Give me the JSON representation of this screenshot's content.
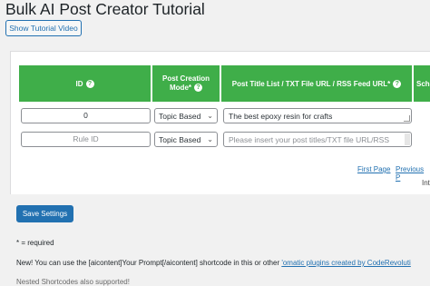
{
  "header": {
    "title": "Bulk AI Post Creator Tutorial",
    "tutorial_button": "Show Tutorial Video"
  },
  "table": {
    "columns": [
      {
        "label": "ID",
        "help_icon": "?"
      },
      {
        "label_line1": "Post Creation",
        "label_line2": "Mode*",
        "help_icon": "?"
      },
      {
        "label": "Post Title List / TXT File URL / RSS Feed URL*",
        "help_icon": "?"
      },
      {
        "label": "Sch"
      }
    ],
    "rows": [
      {
        "id_value": "0",
        "mode": "Topic Based",
        "title_value": "The best epoxy resin for crafts"
      },
      {
        "id_placeholder": "Rule ID",
        "mode": "Topic Based",
        "title_placeholder": "Please insert your post titles/TXT file URL/RSS"
      }
    ]
  },
  "pagination": {
    "first": "First Page",
    "previous": "Previous P",
    "info": "Inte"
  },
  "save_button": "Save Settings",
  "notes": {
    "required": "* = required",
    "new_prefix": "New! You can use the [aicontent]Your Prompt[/aicontent] shortcode in this or other ",
    "new_link": "'omatic plugins created by CodeRevoluti",
    "nested": "Nested Shortcodes also supported!"
  }
}
